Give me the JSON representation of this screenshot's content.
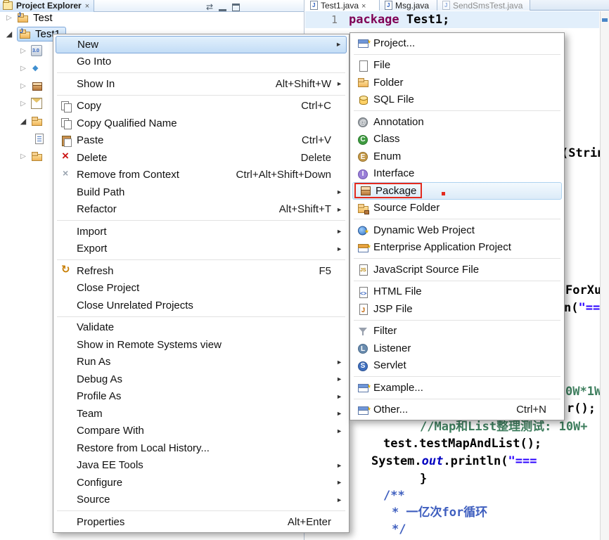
{
  "explorer": {
    "title": "Project Explorer",
    "tree": {
      "project1": "Test",
      "project2": "Test1"
    }
  },
  "editor": {
    "tabs": [
      {
        "label": "Test1.java"
      },
      {
        "label": "Msg.java"
      },
      {
        "label": "SendSmsTest.java"
      }
    ],
    "line1": {
      "number": "1",
      "keyword": "package",
      "code": " Test1;"
    },
    "fragments": {
      "sig": "(Strin",
      "forxu": "ForXu",
      "println_open": "n(",
      "println_str": "\"===",
      "comment_tail": "0W*1W",
      "call_tail": "r();",
      "map_comment": "//Map和List整理测试: 10W+",
      "test_call": "test.testMapAndList();",
      "system": "System.",
      "out": "out",
      "println2": ".println(",
      "str2": "\"===",
      "brace": "}",
      "doc_open": "/**",
      "doc_body": "* 一亿次for循环",
      "doc_close": "*/"
    }
  },
  "context_menu": {
    "items": [
      {
        "label": "New"
      },
      {
        "label": "Go Into"
      },
      {
        "label": "Show In",
        "shortcut": "Alt+Shift+W"
      },
      {
        "label": "Copy",
        "shortcut": "Ctrl+C"
      },
      {
        "label": "Copy Qualified Name"
      },
      {
        "label": "Paste",
        "shortcut": "Ctrl+V"
      },
      {
        "label": "Delete",
        "shortcut": "Delete"
      },
      {
        "label": "Remove from Context",
        "shortcut": "Ctrl+Alt+Shift+Down"
      },
      {
        "label": "Build Path"
      },
      {
        "label": "Refactor",
        "shortcut": "Alt+Shift+T"
      },
      {
        "label": "Import"
      },
      {
        "label": "Export"
      },
      {
        "label": "Refresh",
        "shortcut": "F5"
      },
      {
        "label": "Close Project"
      },
      {
        "label": "Close Unrelated Projects"
      },
      {
        "label": "Validate"
      },
      {
        "label": "Show in Remote Systems view"
      },
      {
        "label": "Run As"
      },
      {
        "label": "Debug As"
      },
      {
        "label": "Profile As"
      },
      {
        "label": "Team"
      },
      {
        "label": "Compare With"
      },
      {
        "label": "Restore from Local History..."
      },
      {
        "label": "Java EE Tools"
      },
      {
        "label": "Configure"
      },
      {
        "label": "Source"
      },
      {
        "label": "Properties",
        "shortcut": "Alt+Enter"
      }
    ]
  },
  "new_submenu": {
    "items": [
      {
        "label": "Project..."
      },
      {
        "label": "File"
      },
      {
        "label": "Folder"
      },
      {
        "label": "SQL File"
      },
      {
        "label": "Annotation"
      },
      {
        "label": "Class"
      },
      {
        "label": "Enum"
      },
      {
        "label": "Interface"
      },
      {
        "label": "Package"
      },
      {
        "label": "Source Folder"
      },
      {
        "label": "Dynamic Web Project"
      },
      {
        "label": "Enterprise Application Project"
      },
      {
        "label": "JavaScript Source File"
      },
      {
        "label": "HTML File"
      },
      {
        "label": "JSP File"
      },
      {
        "label": "Filter"
      },
      {
        "label": "Listener"
      },
      {
        "label": "Servlet"
      },
      {
        "label": "Example..."
      },
      {
        "label": "Other...",
        "shortcut": "Ctrl+N"
      }
    ]
  },
  "colors": {
    "keyword_purple": "#7f0055",
    "string_blue": "#2a00ff",
    "comment_green": "#3f7f5f",
    "javadoc_blue": "#3f5fbf",
    "annotation_red": "#e32a1e",
    "selection_blue": "#bcdbf7"
  }
}
